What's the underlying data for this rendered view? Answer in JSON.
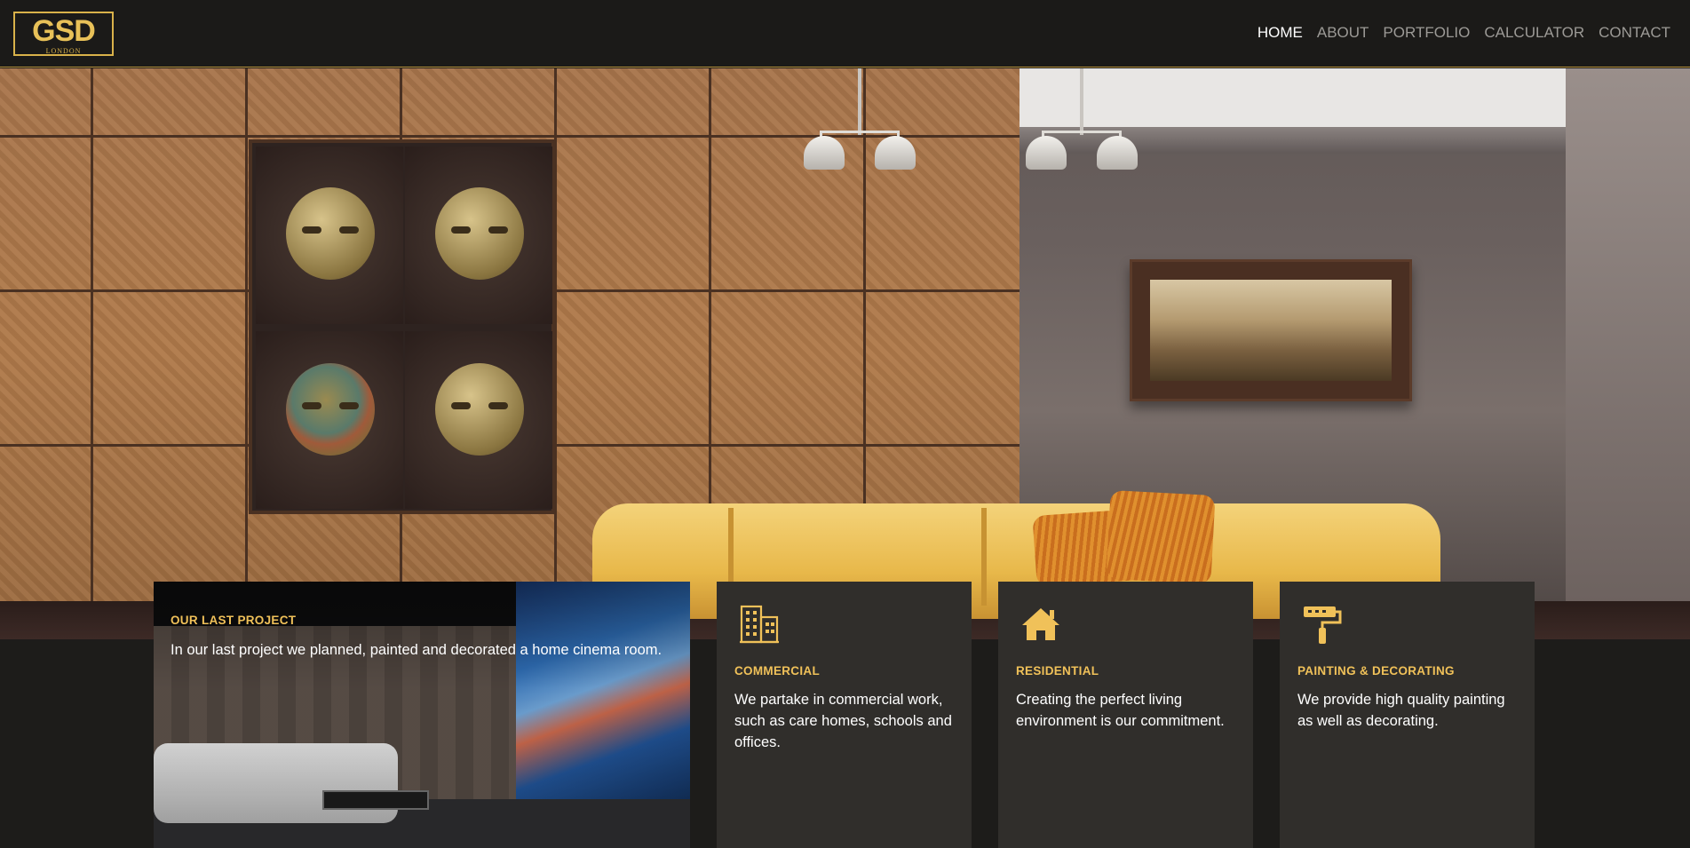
{
  "brand": {
    "logo_main": "GSD",
    "logo_sub": "LONDON"
  },
  "nav": {
    "items": [
      {
        "label": "HOME",
        "active": true
      },
      {
        "label": "ABOUT",
        "active": false
      },
      {
        "label": "PORTFOLIO",
        "active": false
      },
      {
        "label": "CALCULATOR",
        "active": false
      },
      {
        "label": "CONTACT",
        "active": false
      }
    ]
  },
  "colors": {
    "accent": "#f0c159",
    "nav_bg": "#1b1a18",
    "card_bg": "#302e2b",
    "page_bg": "#1d1c1a"
  },
  "project": {
    "heading": "OUR LAST PROJECT",
    "text": "In our last project we planned, painted and decorated a home cinema room."
  },
  "services": [
    {
      "icon": "building-icon",
      "title": "COMMERCIAL",
      "text": "We partake in commercial work, such as care homes, schools and offices."
    },
    {
      "icon": "house-icon",
      "title": "RESIDENTIAL",
      "text": "Creating the perfect living environment is our commitment."
    },
    {
      "icon": "paint-roller-icon",
      "title": "PAINTING & DECORATING",
      "text": "We provide high quality painting as well as decorating."
    }
  ]
}
